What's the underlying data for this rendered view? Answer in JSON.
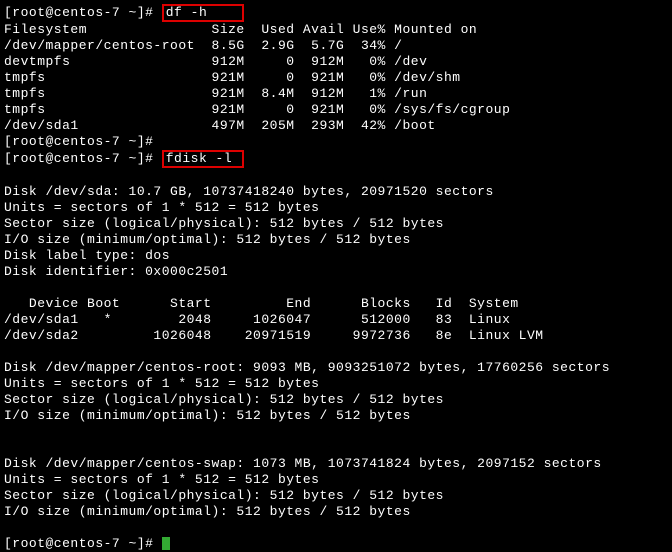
{
  "prompt1": {
    "pre": "[root@centos-7 ~]",
    "hash": "# ",
    "cmd": "df -h    "
  },
  "df_header": "Filesystem               Size  Used Avail Use% Mounted on",
  "df_rows": [
    "/dev/mapper/centos-root  8.5G  2.9G  5.7G  34% /",
    "devtmpfs                 912M     0  912M   0% /dev",
    "tmpfs                    921M     0  921M   0% /dev/shm",
    "tmpfs                    921M  8.4M  912M   1% /run",
    "tmpfs                    921M     0  921M   0% /sys/fs/cgroup",
    "/dev/sda1                497M  205M  293M  42% /boot"
  ],
  "prompt2": "[root@centos-7 ~]#",
  "prompt3": {
    "pre": "[root@centos-7 ~]",
    "hash": "# ",
    "cmd": "fdisk -l "
  },
  "disk_sda": [
    "Disk /dev/sda: 10.7 GB, 10737418240 bytes, 20971520 sectors",
    "Units = sectors of 1 * 512 = 512 bytes",
    "Sector size (logical/physical): 512 bytes / 512 bytes",
    "I/O size (minimum/optimal): 512 bytes / 512 bytes",
    "Disk label type: dos",
    "Disk identifier: 0x000c2501"
  ],
  "part_header": "   Device Boot      Start         End      Blocks   Id  System",
  "part_rows": [
    "/dev/sda1   *        2048     1026047      512000   83  Linux",
    "/dev/sda2         1026048    20971519     9972736   8e  Linux LVM"
  ],
  "disk_root": [
    "Disk /dev/mapper/centos-root: 9093 MB, 9093251072 bytes, 17760256 sectors",
    "Units = sectors of 1 * 512 = 512 bytes",
    "Sector size (logical/physical): 512 bytes / 512 bytes",
    "I/O size (minimum/optimal): 512 bytes / 512 bytes"
  ],
  "disk_swap": [
    "Disk /dev/mapper/centos-swap: 1073 MB, 1073741824 bytes, 2097152 sectors",
    "Units = sectors of 1 * 512 = 512 bytes",
    "Sector size (logical/physical): 512 bytes / 512 bytes",
    "I/O size (minimum/optimal): 512 bytes / 512 bytes"
  ],
  "prompt_final": "[root@centos-7 ~]# "
}
